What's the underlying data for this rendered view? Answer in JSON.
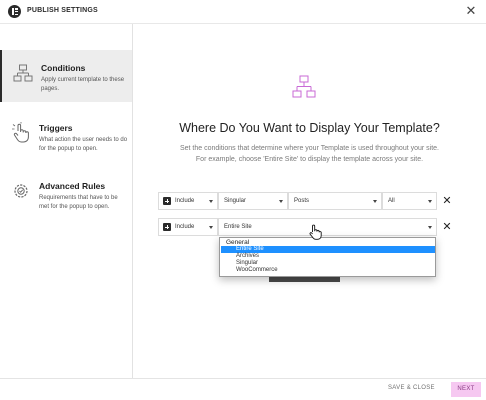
{
  "header": {
    "title": "PUBLISH SETTINGS",
    "close_label": "✕"
  },
  "sidebar": {
    "items": [
      {
        "title": "Conditions",
        "description": "Apply current template to these pages.",
        "icon": "sitemap-icon",
        "active": true
      },
      {
        "title": "Triggers",
        "description": "What action the user needs to do for the popup to open.",
        "icon": "pointer-hand-icon",
        "active": false
      },
      {
        "title": "Advanced Rules",
        "description": "Requirements that have to be met for the popup to open.",
        "icon": "gear-rules-icon",
        "active": false
      }
    ]
  },
  "main": {
    "heading": "Where Do You Want to Display Your Template?",
    "subtitle_line1": "Set the conditions that determine where your Template is used throughout your site.",
    "subtitle_line2": "For example, choose 'Entire Site' to display the template across your site.",
    "rows": [
      {
        "include": "Include",
        "type": "Singular",
        "sub": "Posts",
        "scope": "All",
        "remove_label": "✕"
      },
      {
        "include": "Include",
        "type": "Entire Site",
        "remove_label": "✕"
      }
    ],
    "dropdown": {
      "group": "General",
      "options": [
        "Entire Site",
        "Archives",
        "Singular",
        "WooCommerce"
      ],
      "selected": "Entire Site"
    }
  },
  "footer": {
    "save_label": "SAVE & CLOSE",
    "next_label": "NEXT"
  },
  "colors": {
    "accent_pink": "#f6c8f1",
    "accent_pink_text": "#8b3b86",
    "icon_purple": "#c86ad6",
    "selection_blue": "#1e90ff"
  }
}
